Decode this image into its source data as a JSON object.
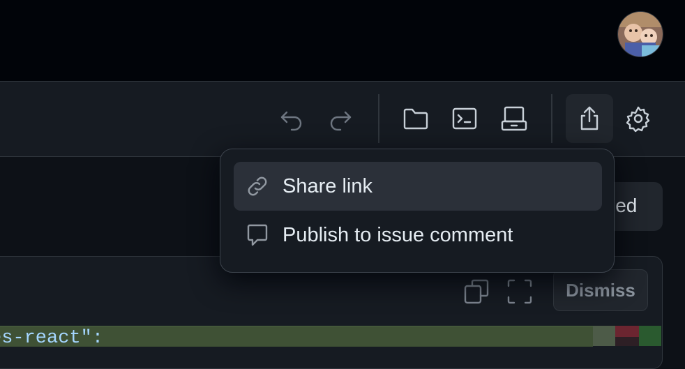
{
  "header": {
    "avatar": {
      "icon": "user-avatar",
      "alt": ""
    }
  },
  "toolbar": {
    "icons": [
      "undo-icon",
      "redo-icon",
      "folder-icon",
      "terminal-icon",
      "server-icon",
      "share-icon",
      "gear-icon"
    ]
  },
  "background": {
    "partial_button_text": "ied",
    "dismiss_label": "Dismiss",
    "code_line": "es-react\":"
  },
  "share_menu": {
    "items": [
      {
        "label": "Share link",
        "icon": "link-icon",
        "highlighted": true
      },
      {
        "label": "Publish to issue comment",
        "icon": "comment-icon",
        "highlighted": false
      }
    ]
  },
  "colors": {
    "page_bg": "#0d1117",
    "topbar_bg": "#010409",
    "menu_bg": "#161b22",
    "menu_hover": "#2b3039",
    "diff_added": "#3f5135"
  }
}
